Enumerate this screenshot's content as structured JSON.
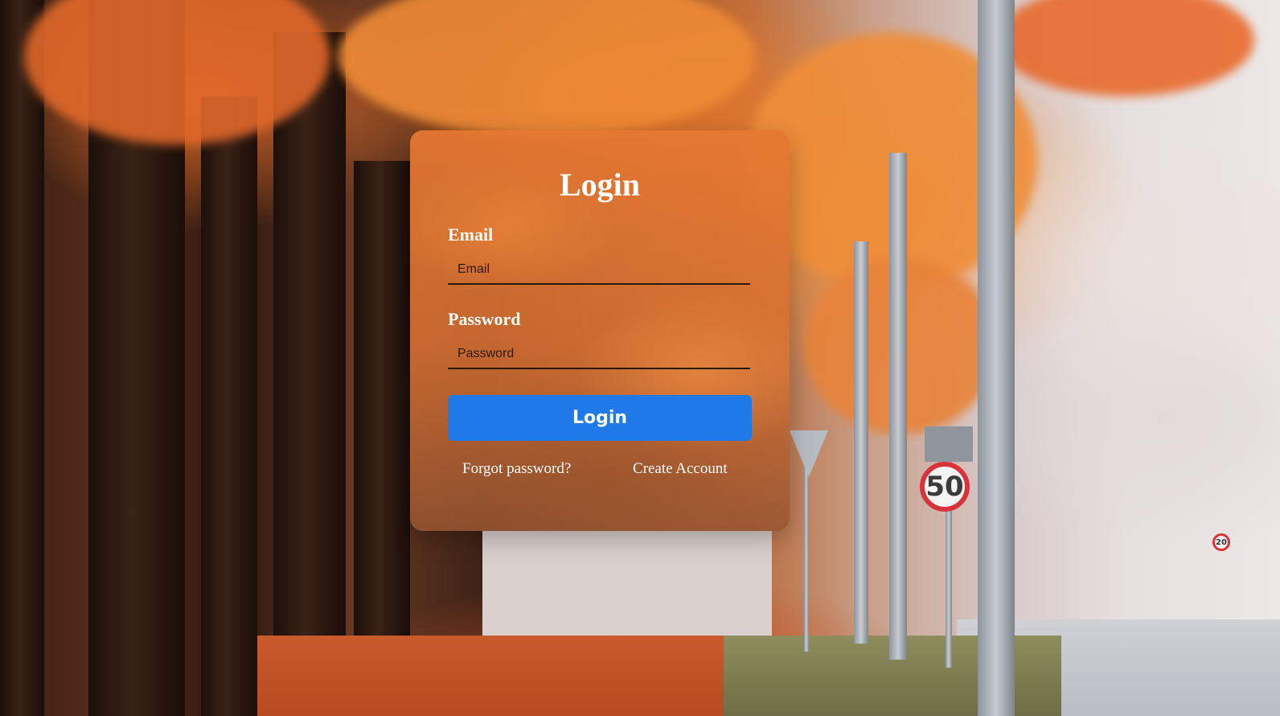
{
  "login_card": {
    "title": "Login",
    "email": {
      "label": "Email",
      "placeholder": "Email",
      "value": ""
    },
    "password": {
      "label": "Password",
      "placeholder": "Password",
      "value": ""
    },
    "submit_label": "Login",
    "forgot_password_label": "Forgot password?",
    "create_account_label": "Create Account"
  },
  "background": {
    "speed_sign_large": "50",
    "speed_sign_small": "20"
  },
  "colors": {
    "button": "#1f7ae8",
    "text": "#ffffff"
  }
}
